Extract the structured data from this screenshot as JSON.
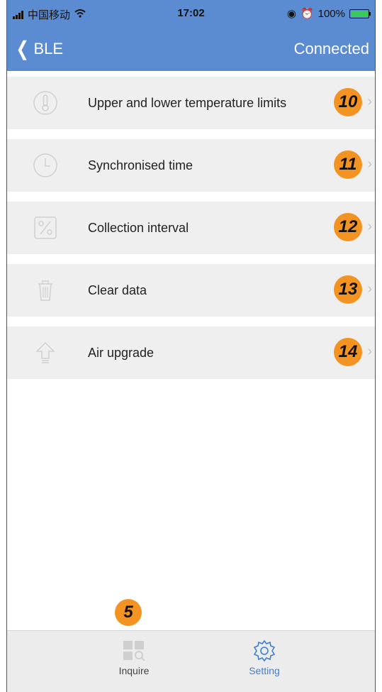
{
  "status_bar": {
    "carrier": "中国移动",
    "time": "17:02",
    "battery_text": "100%",
    "battery_level": 1.0,
    "signal_icon": "signal-icon",
    "wifi_icon": "wifi-icon"
  },
  "nav": {
    "back_label": "BLE",
    "status": "Connected"
  },
  "settings": [
    {
      "label": "Upper and lower temperature limits",
      "badge": "10",
      "icon": "thermometer-icon"
    },
    {
      "label": "Synchronised time",
      "badge": "11",
      "icon": "clock-icon"
    },
    {
      "label": "Collection interval",
      "badge": "12",
      "icon": "percent-icon"
    },
    {
      "label": "Clear data",
      "badge": "13",
      "icon": "trash-icon"
    },
    {
      "label": "Air upgrade",
      "badge": "14",
      "icon": "upload-arrow-icon"
    }
  ],
  "callout": "5",
  "tabbar": {
    "inquire": "Inquire",
    "setting": "Setting"
  },
  "colors": {
    "header": "#5b8bd0",
    "badge": "#f29322",
    "active_tab": "#3f7fd2"
  }
}
